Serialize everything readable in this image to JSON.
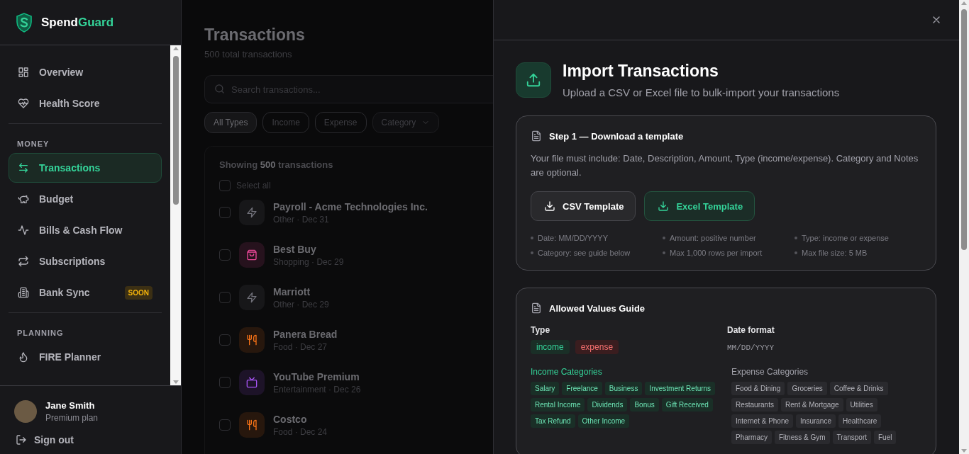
{
  "sidebar": {
    "brand": {
      "name": "Spend",
      "accent": "Guard"
    },
    "sections": [
      {
        "items": [
          {
            "label": "Overview",
            "kind": "grid",
            "selected": false
          },
          {
            "label": "Health Score",
            "kind": "heart",
            "selected": false
          }
        ]
      },
      {
        "label": "MONEY",
        "items": [
          {
            "label": "Transactions",
            "kind": "arrows",
            "selected": true
          },
          {
            "label": "Budget",
            "kind": "piggy",
            "selected": false
          },
          {
            "label": "Bills & Cash Flow",
            "kind": "activity",
            "selected": false
          },
          {
            "label": "Subscriptions",
            "kind": "repeat",
            "selected": false
          },
          {
            "label": "Bank Sync",
            "kind": "building",
            "selected": false,
            "badge": "SOON"
          }
        ]
      },
      {
        "label": "PLANNING",
        "items": [
          {
            "label": "FIRE Planner",
            "kind": "flame",
            "selected": false
          }
        ]
      }
    ],
    "user": {
      "name": "Jane Smith",
      "plan": "Premium plan"
    },
    "sign_out": "Sign out"
  },
  "main": {
    "title": "Transactions",
    "subtitle": "500 total transactions",
    "search": {
      "placeholder": "Search transactions..."
    },
    "filters": [
      {
        "label": "All Types",
        "kind": "chip",
        "selected": true
      },
      {
        "label": "Income",
        "kind": "chip",
        "selected": false
      },
      {
        "label": "Expense",
        "kind": "chip",
        "selected": false
      },
      {
        "label": "Category",
        "kind": "dropdown",
        "selected": false
      }
    ],
    "summary": "Showing **500** transactions",
    "select_all": {
      "label": "Select all",
      "checked": false
    },
    "rows": [
      {
        "name": "Payroll - Acme Technologies Inc.",
        "meta": "Other · Dec 31",
        "kind": "zap",
        "color": "#71717a",
        "checked": false
      },
      {
        "name": "Best Buy",
        "meta": "Shopping · Dec 29",
        "kind": "bag",
        "color": "#ec4899",
        "checked": false
      },
      {
        "name": "Marriott",
        "meta": "Other · Dec 29",
        "kind": "zap",
        "color": "#71717a",
        "checked": false
      },
      {
        "name": "Panera Bread",
        "meta": "Food · Dec 27",
        "kind": "utensils",
        "color": "#f97316",
        "checked": false
      },
      {
        "name": "YouTube Premium",
        "meta": "Entertainment · Dec 26",
        "kind": "tv",
        "color": "#a855f7",
        "checked": false
      },
      {
        "name": "Costco",
        "meta": "Food · Dec 24",
        "kind": "utensils",
        "color": "#f97316",
        "checked": false
      }
    ]
  },
  "drawer": {
    "title": "Import Transactions",
    "subtitle": "Upload a CSV or Excel file to bulk-import your transactions",
    "step1": {
      "title": "Step 1 — Download a template",
      "description": "Your file must include: Date, Description, Amount, Type (income/expense). Category and Notes are optional.",
      "buttons": [
        {
          "label": "CSV Template",
          "kind": "secondary"
        },
        {
          "label": "Excel Template",
          "kind": "primary"
        }
      ],
      "rules": [
        "Date: MM/DD/YYYY",
        "Amount: positive number",
        "Type: income or expense",
        "Category: see guide below",
        "Max 1,000 rows per import",
        "Max file size: 5 MB"
      ]
    },
    "guide": {
      "title": "Allowed Values Guide",
      "type_label": "Type",
      "types": [
        {
          "label": "income",
          "kind": "income"
        },
        {
          "label": "expense",
          "kind": "expense"
        }
      ],
      "date_label": "Date format",
      "date_value": "MM/DD/YYYY",
      "income_title": "Income Categories",
      "income_categories": [
        "Salary",
        "Freelance",
        "Business",
        "Investment Returns",
        "Rental Income",
        "Dividends",
        "Bonus",
        "Gift Received",
        "Tax Refund",
        "Other Income"
      ],
      "expense_title": "Expense Categories",
      "expense_categories": [
        "Food & Dining",
        "Groceries",
        "Coffee & Drinks",
        "Restaurants",
        "Rent & Mortgage",
        "Utilities",
        "Internet & Phone",
        "Insurance",
        "Healthcare",
        "Pharmacy",
        "Fitness & Gym",
        "Transport",
        "Fuel"
      ]
    }
  }
}
